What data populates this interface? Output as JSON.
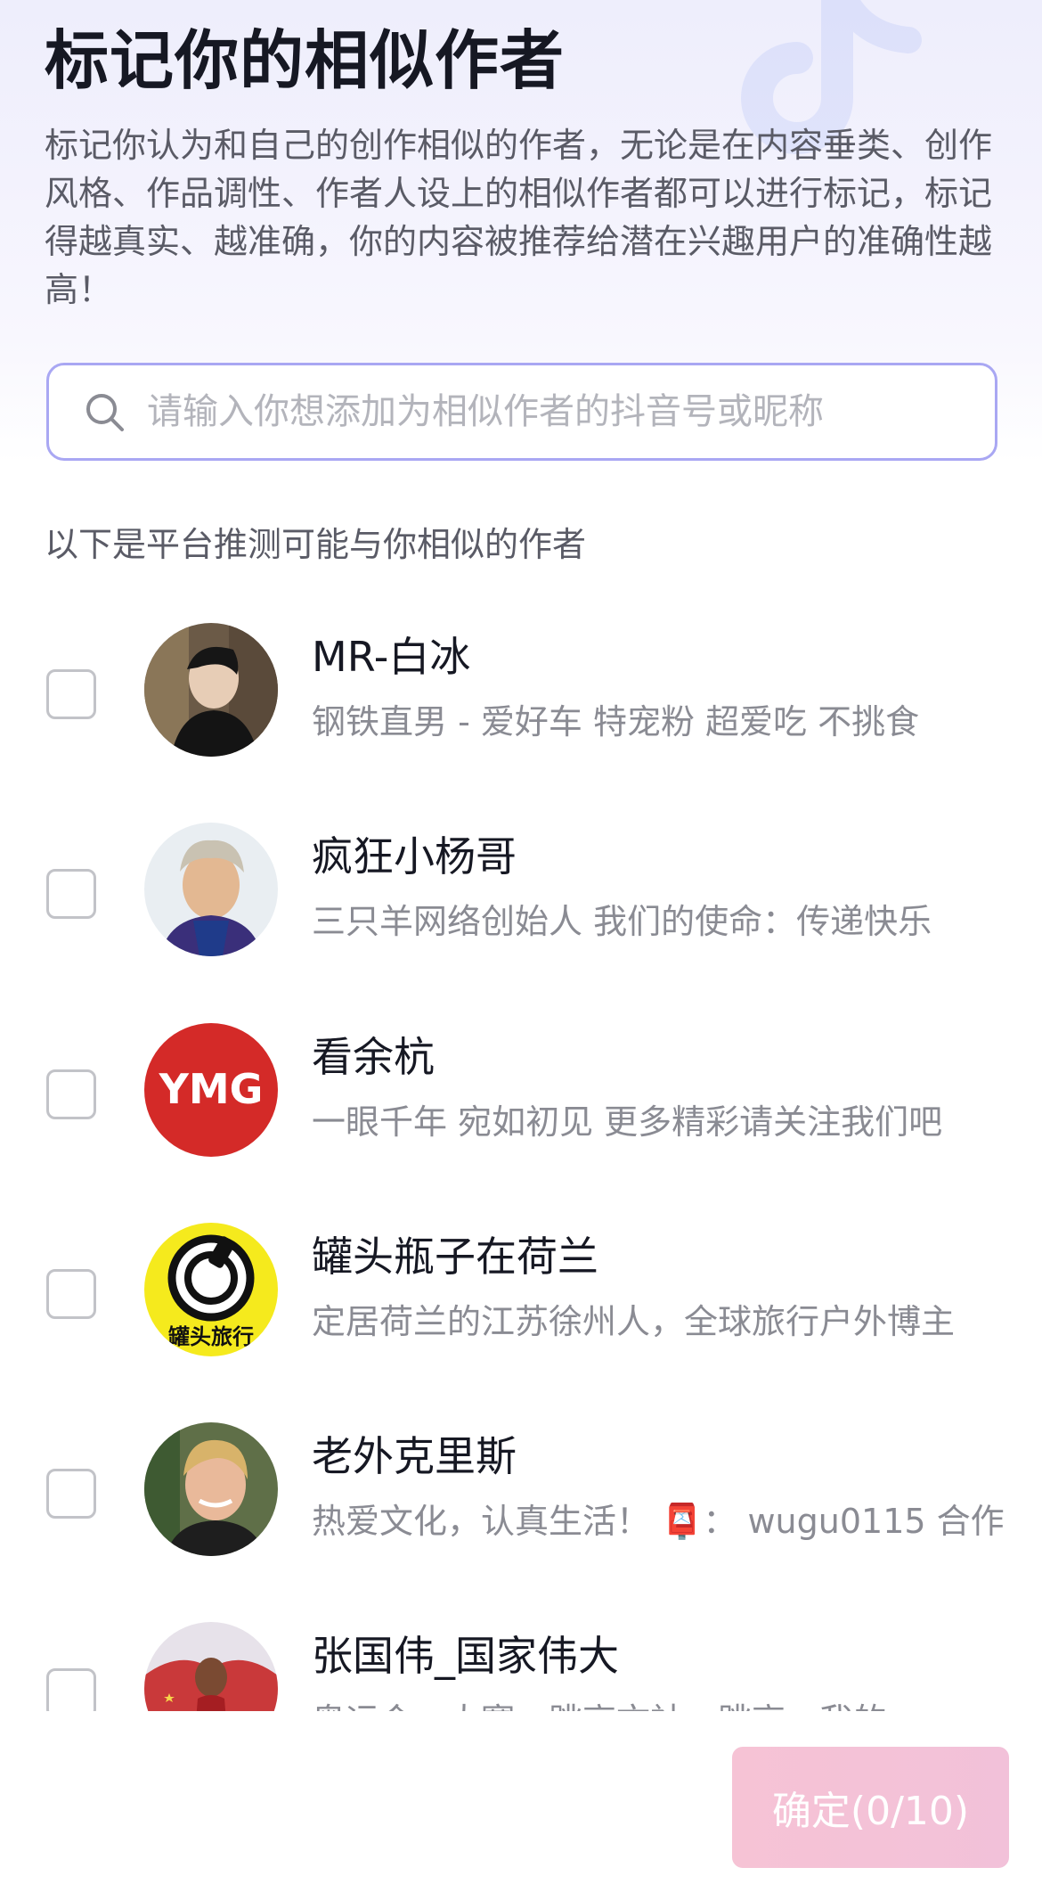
{
  "header": {
    "title": "标记你的相似作者",
    "description": "标记你认为和自己的创作相似的作者，无论是在内容垂类、创作风格、作品调性、作者人设上的相似作者都可以进行标记，标记得越真实、越准确，你的内容被推荐给潜在兴趣用户的准确性越高！"
  },
  "search": {
    "icon": "search-icon",
    "placeholder": "请输入你想添加为相似作者的抖音号或昵称",
    "value": ""
  },
  "section": {
    "label": "以下是平台推测可能与你相似的作者"
  },
  "authors": [
    {
      "name": "MR-白冰",
      "bio": "钢铁直男 - 爱好车 特宠粉 超爱吃 不挑食",
      "checked": false,
      "avatar_color": "#3b3228"
    },
    {
      "name": "疯狂小杨哥",
      "bio": "三只羊网络创始人 我们的使命：传递快乐",
      "checked": false,
      "avatar_color": "#4a3f7a"
    },
    {
      "name": "看余杭",
      "bio": "一眼千年 宛如初见 更多精彩请关注我们吧",
      "checked": false,
      "avatar_color": "#d42a28",
      "avatar_text": "YMG"
    },
    {
      "name": "罐头瓶子在荷兰",
      "bio": "定居荷兰的江苏徐州人，全球旅行户外博主",
      "checked": false,
      "avatar_color": "#f5ea1d",
      "avatar_text": "罐头旅行"
    },
    {
      "name": "老外克里斯",
      "bio": "热爱文化，认真生活！ 📮： wugu0115 合作",
      "checked": false,
      "avatar_color": "#5f6f48"
    },
    {
      "name": "张国伟_国家伟大",
      "bio": "奥运会，大赛，跳高文社，跳高，我的",
      "checked": false,
      "avatar_color": "#c9393a"
    }
  ],
  "footer": {
    "confirm_label": "确定(0/10)",
    "selected_count": 0,
    "max_count": 10
  },
  "colors": {
    "accent_border": "#a9a7f3",
    "confirm_bg": "#f6c3d5",
    "text_primary": "#161823",
    "text_secondary": "#8a8b93"
  }
}
